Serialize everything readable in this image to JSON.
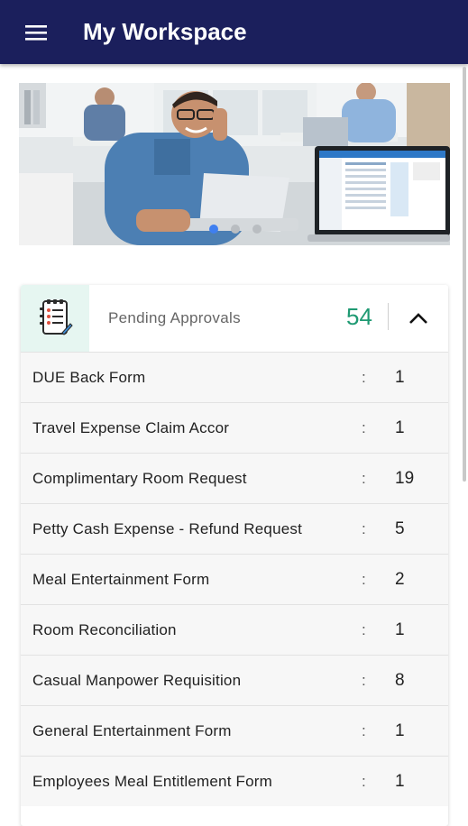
{
  "app_bar": {
    "title": "My Workspace",
    "menu_icon": "hamburger-menu-icon",
    "background": "#1b1f5c"
  },
  "banner": {
    "description_icon": "office-photo",
    "dots_count": 3,
    "active_dot": 0
  },
  "pending_approvals": {
    "title": "Pending Approvals",
    "count": "54",
    "count_color": "#1f9a73",
    "icon": "checklist-notebook-icon",
    "collapse_icon": "chevron-up-icon",
    "separator": ":",
    "items": [
      {
        "label": "DUE Back Form",
        "value": "1"
      },
      {
        "label": "Travel Expense Claim Accor",
        "value": "1"
      },
      {
        "label": "Complimentary Room Request",
        "value": "19"
      },
      {
        "label": "Petty Cash Expense - Refund Request",
        "value": "5"
      },
      {
        "label": "Meal Entertainment Form",
        "value": "2"
      },
      {
        "label": "Room Reconciliation",
        "value": "1"
      },
      {
        "label": "Casual Manpower Requisition",
        "value": "8"
      },
      {
        "label": "General Entertainment Form",
        "value": "1"
      },
      {
        "label": "Employees Meal Entitlement Form",
        "value": "1"
      }
    ]
  }
}
